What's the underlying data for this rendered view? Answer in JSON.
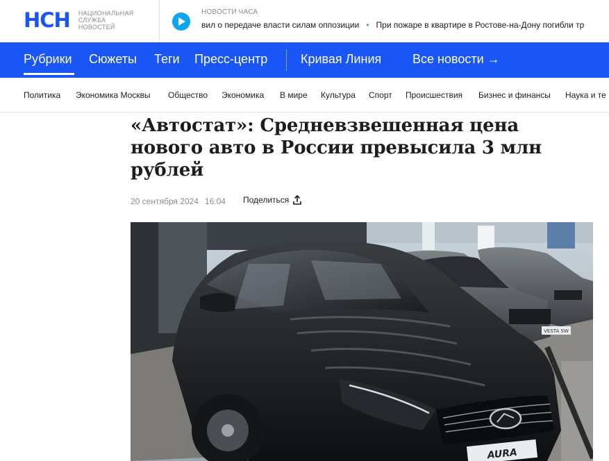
{
  "header": {
    "logo_text": "НСН",
    "logo_caption": [
      "НАЦИОНАЛЬНАЯ",
      "СЛУЖБА",
      "НОВОСТЕЙ"
    ],
    "news_hour_label": "НОВОСТИ ЧАСА",
    "ticker": [
      "вил о передаче власти силам оппозиции",
      "При пожаре в квартире в Ростове-на-Дону погибли тр"
    ]
  },
  "main_nav": {
    "items": [
      "Рубрики",
      "Сюжеты",
      "Теги",
      "Пресс-центр"
    ],
    "special": "Кривая Линия",
    "all_news": "Все новости →"
  },
  "categories": [
    "Политика",
    "Экономика Москвы",
    "Общество",
    "Экономика",
    "В мире",
    "Культура",
    "Спорт",
    "Происшествия",
    "Бизнес и финансы",
    "Наука и те"
  ],
  "article": {
    "title": "«Автостат»: Средневзвешенная цена нового авто в России превысила 3 млн рублей",
    "date": "20 сентября 2024",
    "time": "16:04",
    "share_label": "Поделиться",
    "photo_plate": "AURA",
    "photo_plate_2": "VESTA SW"
  },
  "colors": {
    "brand_blue": "#1a55f5",
    "accent_cyan": "#0ea5ef",
    "muted_text": "#8b8b8b"
  },
  "icons": {
    "play": "play-icon",
    "share": "share-icon"
  }
}
